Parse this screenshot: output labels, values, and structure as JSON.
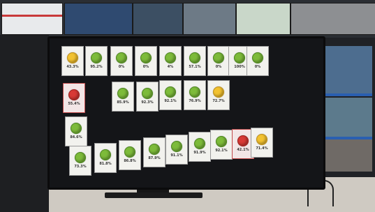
{
  "wall_screens": {
    "left_text_top": "",
    "left_text_bottom": ""
  },
  "dashboard": {
    "tiles": [
      {
        "value": "43.3%",
        "status": "yellow"
      },
      {
        "value": "95.2%",
        "status": "green"
      },
      {
        "value": "0%",
        "status": "green"
      },
      {
        "value": "0%",
        "status": "green"
      },
      {
        "value": "4%",
        "status": "green"
      },
      {
        "value": "57.1%",
        "status": "green"
      },
      {
        "value": "0%",
        "status": "green"
      },
      {
        "value": "100%",
        "status": "green"
      },
      {
        "value": "0%",
        "status": "green"
      },
      {
        "value": "55.4%",
        "status": "red"
      },
      {
        "value": "85.9%",
        "status": "green"
      },
      {
        "value": "92.3%",
        "status": "green"
      },
      {
        "value": "92.1%",
        "status": "green"
      },
      {
        "value": "76.9%",
        "status": "green"
      },
      {
        "value": "72.7%",
        "status": "yellow"
      },
      {
        "value": "84.6%",
        "status": "green"
      },
      {
        "value": "73.3%",
        "status": "green"
      },
      {
        "value": "81.8%",
        "status": "green"
      },
      {
        "value": "86.8%",
        "status": "green"
      },
      {
        "value": "87.9%",
        "status": "green"
      },
      {
        "value": "91.1%",
        "status": "green"
      },
      {
        "value": "91.9%",
        "status": "green"
      },
      {
        "value": "92.1%",
        "status": "green"
      },
      {
        "value": "42.1%",
        "status": "red"
      },
      {
        "value": "71.4%",
        "status": "yellow"
      }
    ]
  }
}
